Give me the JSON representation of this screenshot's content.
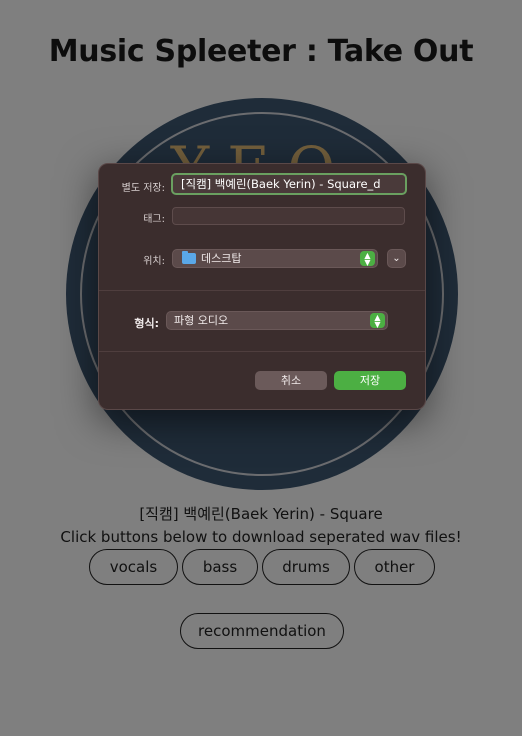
{
  "page": {
    "title": "Music Spleeter : Take Out",
    "album_art_text": "YEO",
    "song_title": "[직캠] 백예린(Baek Yerin) - Square",
    "instruction": "Click buttons below to download seperated wav files!",
    "buttons": [
      "vocals",
      "bass",
      "drums",
      "other"
    ],
    "recommendation_label": "recommendation"
  },
  "dialog": {
    "save_as_label": "별도 저장:",
    "filename_value": "[직캠] 백예린(Baek Yerin) - Square_d",
    "tags_label": "태그:",
    "tags_value": "",
    "where_label": "위치:",
    "where_value": "데스크탑",
    "where_icon": "folder-icon",
    "format_label": "형식:",
    "format_value": "파형 오디오",
    "cancel_label": "취소",
    "save_label": "저장",
    "accent_color": "#4caf43"
  }
}
